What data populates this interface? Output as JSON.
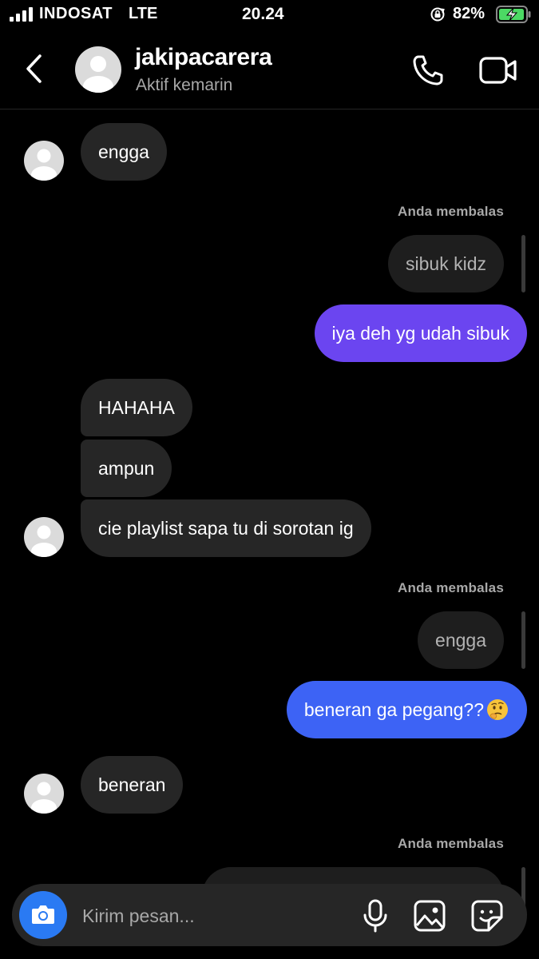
{
  "status_bar": {
    "carrier": "INDOSAT",
    "network": "LTE",
    "time": "20.24",
    "battery": "82%"
  },
  "header": {
    "username": "jakipacarera",
    "presence": "Aktif kemarin",
    "icons": [
      "chevron-left-icon",
      "avatar",
      "phone-icon",
      "video-camera-icon"
    ]
  },
  "messages": {
    "m1": "engga",
    "reply_label_1": "Anda membalas",
    "reply_quote_1": "sibuk kidz",
    "sent_1": "iya deh yg udah sibuk",
    "m2": "HAHAHA",
    "m3": "ampun",
    "m4": "cie playlist sapa tu di sorotan ig",
    "reply_label_2": "Anda membalas",
    "reply_quote_2": "engga",
    "sent_2": "beneran ga pegang??",
    "m5": "beneran",
    "reply_label_3": "Anda membalas"
  },
  "composer": {
    "placeholder": "Kirim pesan...",
    "icons": [
      "camera-icon",
      "microphone-icon",
      "image-icon",
      "sticker-icon"
    ]
  },
  "colors": {
    "background": "#000000",
    "incoming_bubble": "#262626",
    "sent_bubble_purple": "#6b45f0",
    "sent_bubble_blue": "#3d63f5",
    "camera_button": "#2a7af3",
    "secondary_text": "#a8a8a8"
  }
}
